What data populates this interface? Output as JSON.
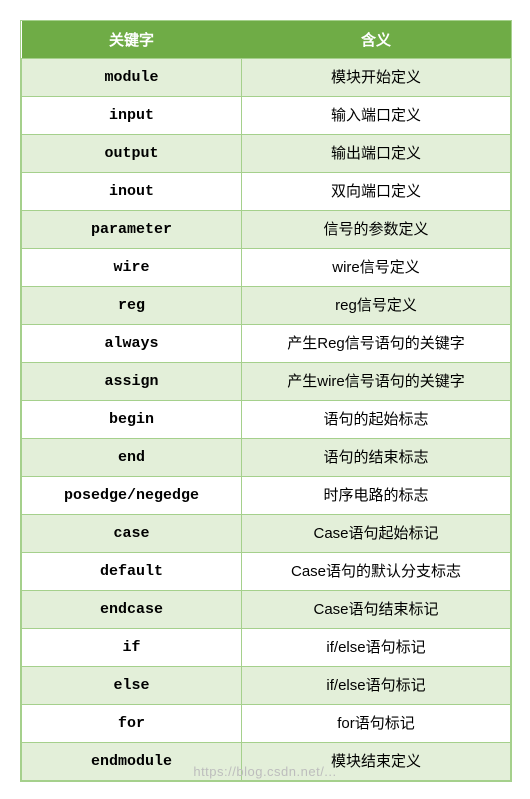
{
  "headers": {
    "keyword": "关键字",
    "meaning": "含义"
  },
  "rows": [
    {
      "keyword": "module",
      "meaning": "模块开始定义"
    },
    {
      "keyword": "input",
      "meaning": "输入端口定义"
    },
    {
      "keyword": "output",
      "meaning": "输出端口定义"
    },
    {
      "keyword": "inout",
      "meaning": "双向端口定义"
    },
    {
      "keyword": "parameter",
      "meaning": "信号的参数定义"
    },
    {
      "keyword": "wire",
      "meaning": "wire信号定义"
    },
    {
      "keyword": "reg",
      "meaning": "reg信号定义"
    },
    {
      "keyword": "always",
      "meaning": "产生Reg信号语句的关键字"
    },
    {
      "keyword": "assign",
      "meaning": "产生wire信号语句的关键字"
    },
    {
      "keyword": "begin",
      "meaning": "语句的起始标志"
    },
    {
      "keyword": "end",
      "meaning": "语句的结束标志"
    },
    {
      "keyword": "posedge/negedge",
      "meaning": "时序电路的标志"
    },
    {
      "keyword": "case",
      "meaning": "Case语句起始标记"
    },
    {
      "keyword": "default",
      "meaning": "Case语句的默认分支标志"
    },
    {
      "keyword": "endcase",
      "meaning": "Case语句结束标记"
    },
    {
      "keyword": "if",
      "meaning": "if/else语句标记"
    },
    {
      "keyword": "else",
      "meaning": "if/else语句标记"
    },
    {
      "keyword": "for",
      "meaning": "for语句标记"
    },
    {
      "keyword": "endmodule",
      "meaning": "模块结束定义"
    }
  ],
  "watermark": "https://blog.csdn.net/..."
}
